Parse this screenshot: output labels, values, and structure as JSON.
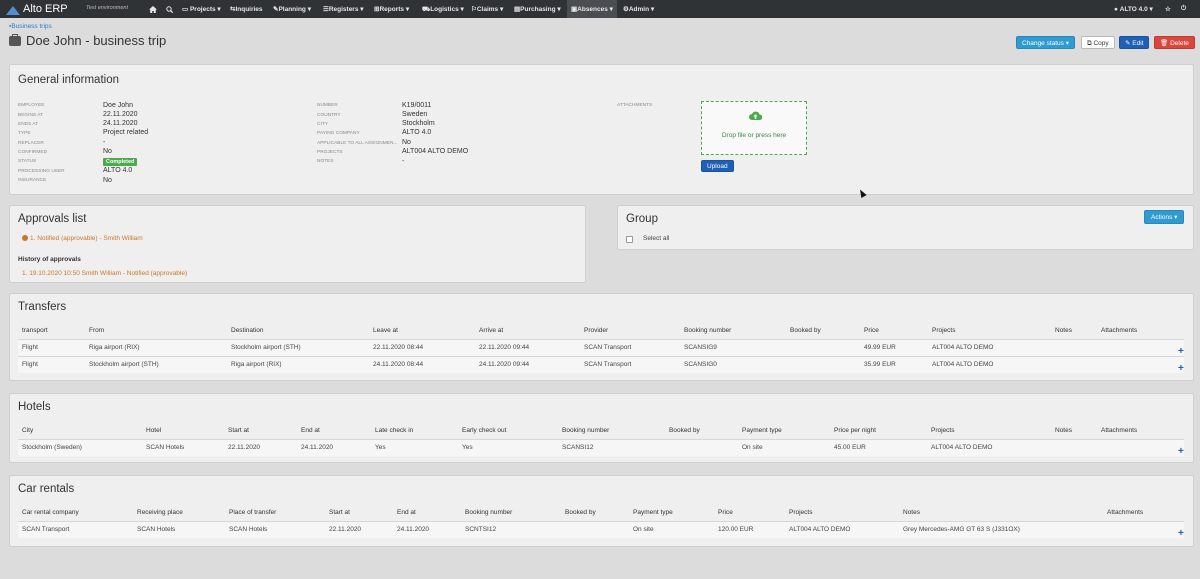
{
  "topbar": {
    "app_name": "Alto ERP",
    "environment": "Test environment",
    "nav": [
      "Projects ▾",
      "Inquiries",
      "Planning ▾",
      "Registers ▾",
      "Reports ▾",
      "Logistics ▾",
      "Claims ▾",
      "Purchasing ▾",
      "Absences ▾",
      "Admin ▾"
    ],
    "user": "ALTO 4.0 ▾"
  },
  "breadcrumb": "Business trips",
  "title": "Doe John - business trip",
  "actions": {
    "change_status": "Change status ▾",
    "copy": "Copy",
    "edit": "Edit",
    "delete": "Delete"
  },
  "general": {
    "heading": "General information",
    "col1": [
      {
        "label": "Employee",
        "value": "Doe John"
      },
      {
        "label": "Begins at",
        "value": "22.11.2020"
      },
      {
        "label": "Ends at",
        "value": "24.11.2020"
      },
      {
        "label": "Type",
        "value": "Project related"
      },
      {
        "label": "Replacer",
        "value": "-"
      },
      {
        "label": "Confirmed",
        "value": "No"
      },
      {
        "label": "Status",
        "value": "Completed"
      },
      {
        "label": "Processing user",
        "value": "ALTO 4.0"
      },
      {
        "label": "Insurance",
        "value": "No"
      }
    ],
    "col2": [
      {
        "label": "Number",
        "value": "K19/0011"
      },
      {
        "label": "Country",
        "value": "Sweden"
      },
      {
        "label": "City",
        "value": "Stockholm"
      },
      {
        "label": "Paying company",
        "value": "ALTO 4.0"
      },
      {
        "label": "Applicable to all assignmen...",
        "value": "No"
      },
      {
        "label": "Projects",
        "value": "ALT004 ALTO DEMO"
      },
      {
        "label": "Notes",
        "value": "-"
      }
    ],
    "attachments_label": "Attachments",
    "dropzone_text": "Drop file or press here",
    "upload": "Upload"
  },
  "approvals": {
    "heading": "Approvals list",
    "item": "1.  Notified (approvable) - Smith William",
    "history_heading": "History of approvals",
    "history_item": "1.  19.10.2020 10:50 Smith William - Notified (approvable)"
  },
  "group": {
    "heading": "Group",
    "actions": "Actions ▾",
    "select_all": "Select all"
  },
  "transfers": {
    "heading": "Transfers",
    "columns": [
      "transport",
      "From",
      "Destination",
      "Leave at",
      "Arrive at",
      "Provider",
      "Booking number",
      "Booked by",
      "Price",
      "Projects",
      "Notes",
      "Attachments"
    ],
    "rows": [
      [
        "Flight",
        "Riga airport (RIX)",
        "Stockholm airport (STH)",
        "22.11.2020 08:44",
        "22.11.2020 09:44",
        "SCAN Transport",
        "SCANSIG9",
        "",
        "49.99 EUR",
        "ALT004 ALTO DEMO",
        "",
        ""
      ],
      [
        "Flight",
        "Stockholm airport (STH)",
        "Riga airport (RIX)",
        "24.11.2020 08:44",
        "24.11.2020 09:44",
        "SCAN Transport",
        "SCANSIG0",
        "",
        "35.99 EUR",
        "ALT004 ALTO DEMO",
        "",
        ""
      ]
    ]
  },
  "hotels": {
    "heading": "Hotels",
    "columns": [
      "City",
      "Hotel",
      "Start at",
      "End at",
      "Late check in",
      "Early check out",
      "Booking number",
      "Booked by",
      "Payment type",
      "Price per night",
      "Projects",
      "Notes",
      "Attachments"
    ],
    "rows": [
      [
        "Stockholm (Sweden)",
        "SCAN Hotels",
        "22.11.2020",
        "24.11.2020",
        "Yes",
        "Yes",
        "SCANSI12",
        "",
        "On site",
        "45.00 EUR",
        "ALT004 ALTO DEMO",
        "",
        ""
      ]
    ]
  },
  "cars": {
    "heading": "Car rentals",
    "columns": [
      "Car rental company",
      "Receiving place",
      "Place of transfer",
      "Start at",
      "End at",
      "Booking number",
      "Booked by",
      "Payment type",
      "Price",
      "Projects",
      "Notes",
      "Attachments"
    ],
    "rows": [
      [
        "SCAN Transport",
        "SCAN Hotels",
        "SCAN Hotels",
        "22.11.2020",
        "24.11.2020",
        "SCNTSI12",
        "",
        "On site",
        "120.00 EUR",
        "ALT004 ALTO DEMO",
        "Grey Mercedes-AMG GT 63 S (J331OX)",
        ""
      ]
    ]
  },
  "add_symbol": "+"
}
